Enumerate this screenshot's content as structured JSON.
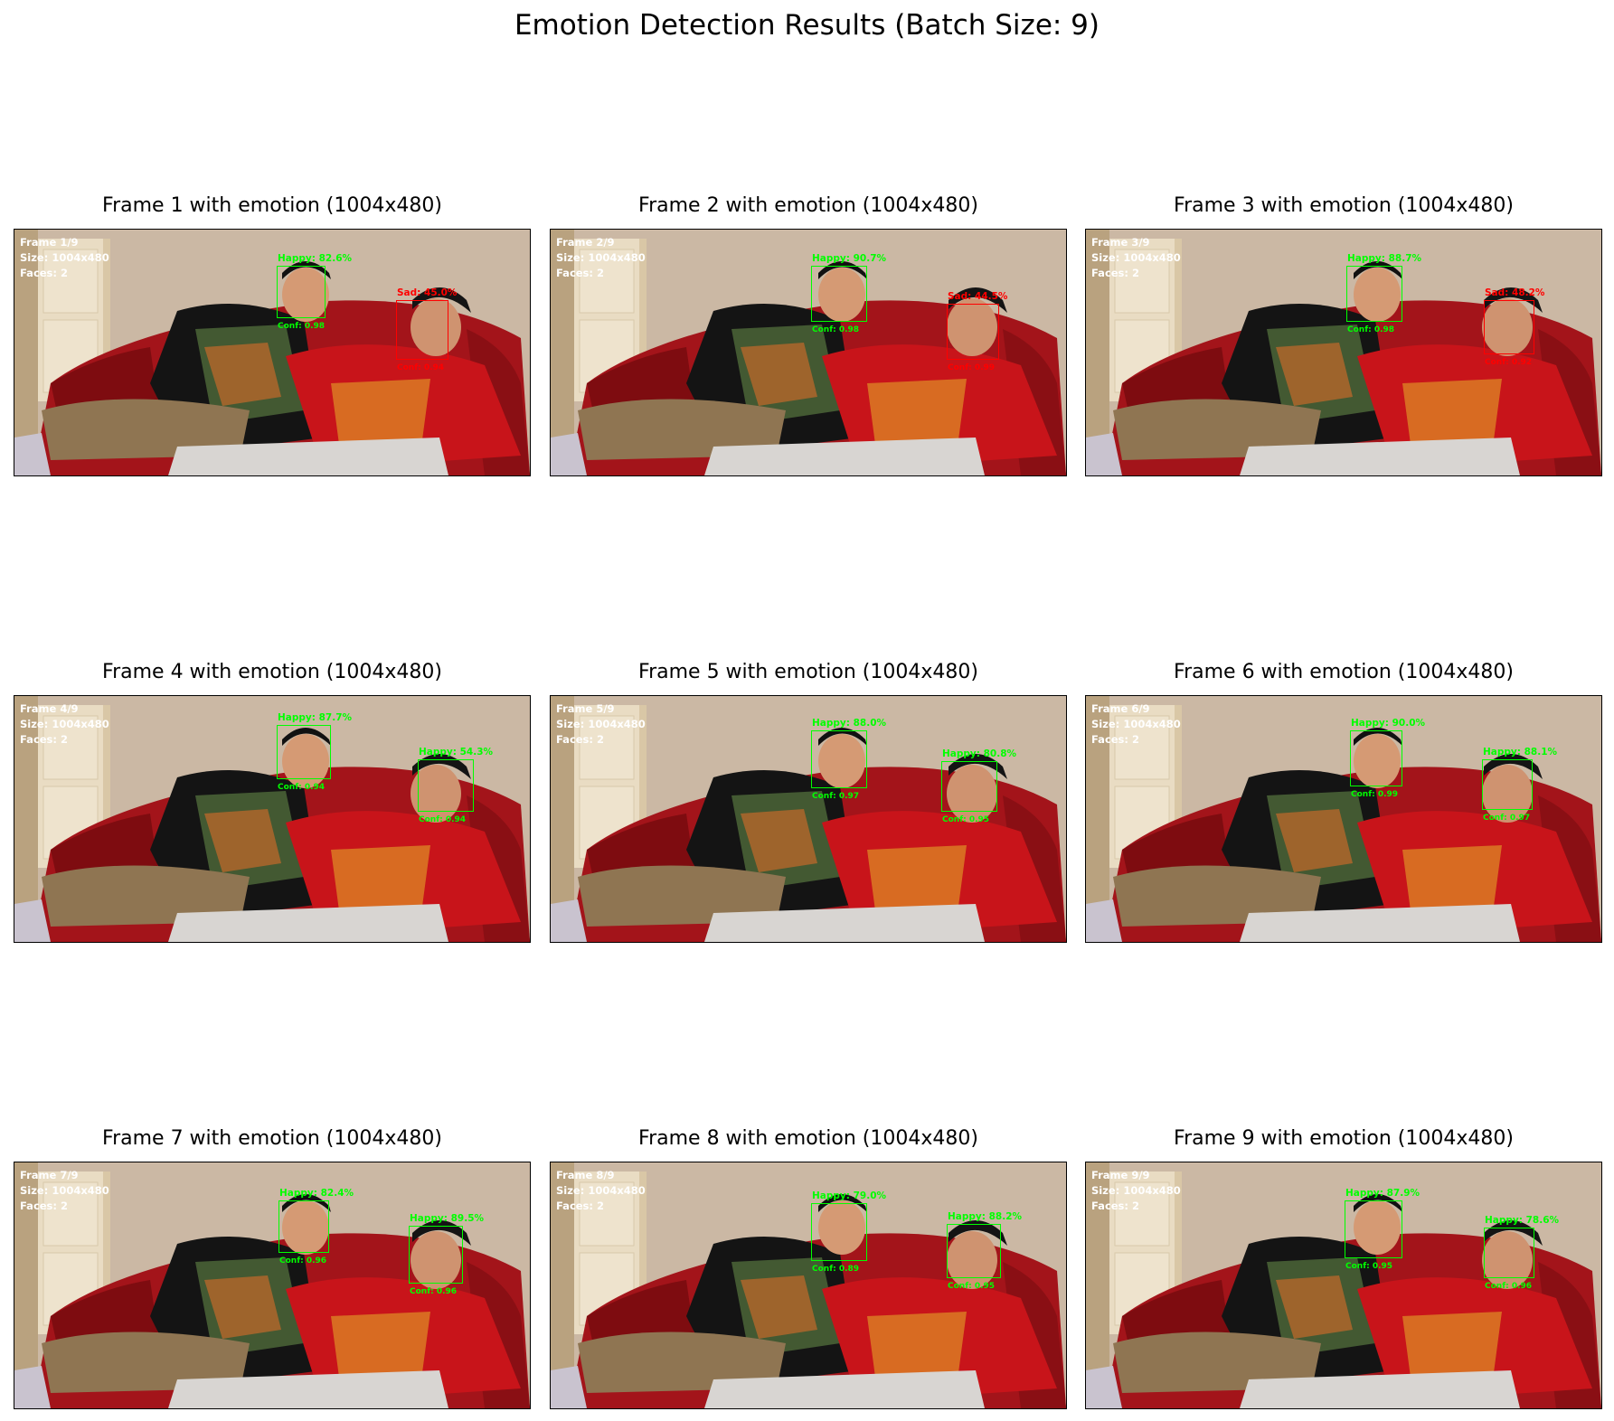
{
  "figure": {
    "title": "Emotion Detection Results (Batch Size: 9)"
  },
  "colors": {
    "happy": "#00ff00",
    "sad": "#ff0000",
    "info_text": "#ffffff"
  },
  "frames": [
    {
      "title": "Frame 1 with emotion (1004x480)",
      "info": [
        "Frame 1/9",
        "Size: 1004x480",
        "Faces: 2"
      ],
      "faces": [
        {
          "emotion": "Happy: 82.6%",
          "conf": "Conf: 0.98",
          "kind": "happy"
        },
        {
          "emotion": "Sad: 45.0%",
          "conf": "Conf: 0.94",
          "kind": "sad"
        }
      ]
    },
    {
      "title": "Frame 2 with emotion (1004x480)",
      "info": [
        "Frame 2/9",
        "Size: 1004x480",
        "Faces: 2"
      ],
      "faces": [
        {
          "emotion": "Happy: 90.7%",
          "conf": "Conf: 0.98",
          "kind": "happy"
        },
        {
          "emotion": "Sad: 44.5%",
          "conf": "Conf: 0.99",
          "kind": "sad"
        }
      ]
    },
    {
      "title": "Frame 3 with emotion (1004x480)",
      "info": [
        "Frame 3/9",
        "Size: 1004x480",
        "Faces: 2"
      ],
      "faces": [
        {
          "emotion": "Happy: 88.7%",
          "conf": "Conf: 0.98",
          "kind": "happy"
        },
        {
          "emotion": "Sad: 48.2%",
          "conf": "Conf: 0.92",
          "kind": "sad"
        }
      ]
    },
    {
      "title": "Frame 4 with emotion (1004x480)",
      "info": [
        "Frame 4/9",
        "Size: 1004x480",
        "Faces: 2"
      ],
      "faces": [
        {
          "emotion": "Happy: 87.7%",
          "conf": "Conf: 0.94",
          "kind": "happy"
        },
        {
          "emotion": "Happy: 54.3%",
          "conf": "Conf: 0.94",
          "kind": "happy"
        }
      ]
    },
    {
      "title": "Frame 5 with emotion (1004x480)",
      "info": [
        "Frame 5/9",
        "Size: 1004x480",
        "Faces: 2"
      ],
      "faces": [
        {
          "emotion": "Happy: 88.0%",
          "conf": "Conf: 0.97",
          "kind": "happy"
        },
        {
          "emotion": "Happy: 80.8%",
          "conf": "Conf: 0.95",
          "kind": "happy"
        }
      ]
    },
    {
      "title": "Frame 6 with emotion (1004x480)",
      "info": [
        "Frame 6/9",
        "Size: 1004x480",
        "Faces: 2"
      ],
      "faces": [
        {
          "emotion": "Happy: 90.0%",
          "conf": "Conf: 0.99",
          "kind": "happy"
        },
        {
          "emotion": "Happy: 88.1%",
          "conf": "Conf: 0.97",
          "kind": "happy"
        }
      ]
    },
    {
      "title": "Frame 7 with emotion (1004x480)",
      "info": [
        "Frame 7/9",
        "Size: 1004x480",
        "Faces: 2"
      ],
      "faces": [
        {
          "emotion": "Happy: 82.4%",
          "conf": "Conf: 0.96",
          "kind": "happy"
        },
        {
          "emotion": "Happy: 89.5%",
          "conf": "Conf: 0.96",
          "kind": "happy"
        }
      ]
    },
    {
      "title": "Frame 8 with emotion (1004x480)",
      "info": [
        "Frame 8/9",
        "Size: 1004x480",
        "Faces: 2"
      ],
      "faces": [
        {
          "emotion": "Happy: 79.0%",
          "conf": "Conf: 0.89",
          "kind": "happy"
        },
        {
          "emotion": "Happy: 88.2%",
          "conf": "Conf: 0.95",
          "kind": "happy"
        }
      ]
    },
    {
      "title": "Frame 9 with emotion (1004x480)",
      "info": [
        "Frame 9/9",
        "Size: 1004x480",
        "Faces: 2"
      ],
      "faces": [
        {
          "emotion": "Happy: 87.9%",
          "conf": "Conf: 0.95",
          "kind": "happy"
        },
        {
          "emotion": "Happy: 78.6%",
          "conf": "Conf: 0.96",
          "kind": "happy"
        }
      ]
    }
  ]
}
